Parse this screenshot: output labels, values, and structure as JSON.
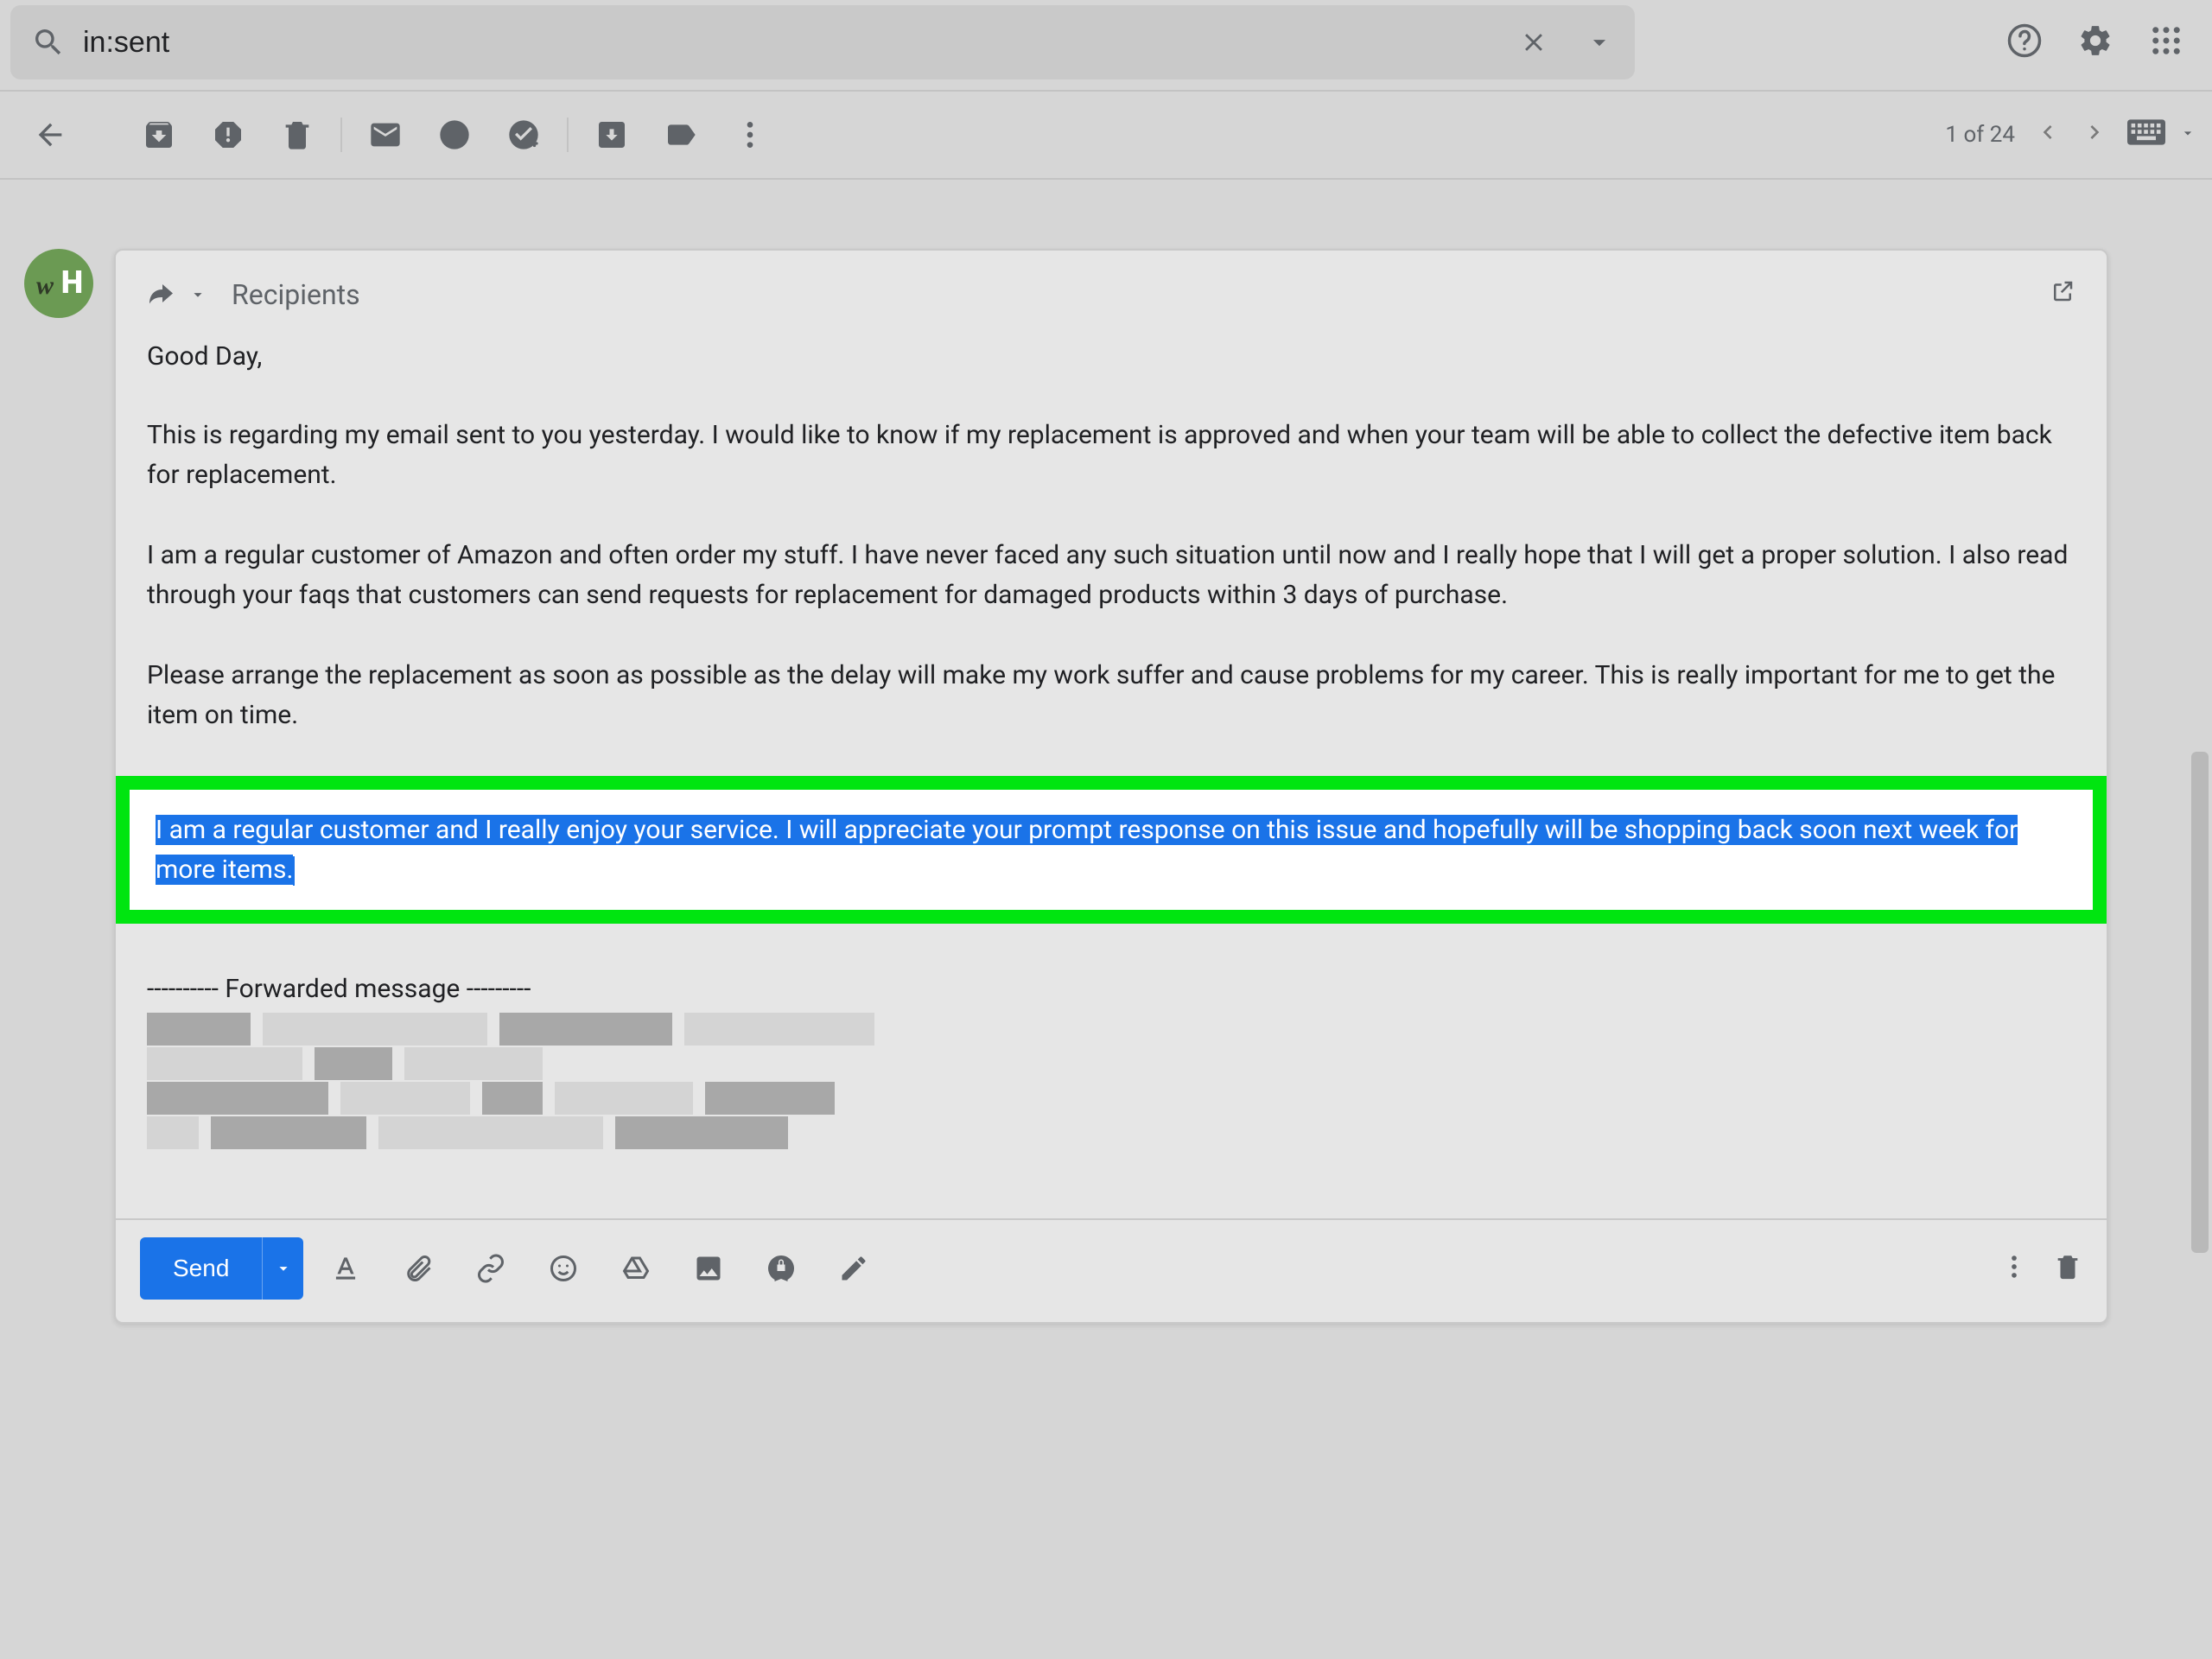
{
  "search": {
    "value": "in:sent"
  },
  "toolbar": {
    "pager": "1 of 24"
  },
  "compose": {
    "recipients_label": "Recipients",
    "greeting": "Good Day,",
    "para1": "This is regarding my email sent to you yesterday. I would like to know if my replacement is approved and when your team will be able to collect the defective item back for replacement.",
    "para2": "I am a regular customer of Amazon and often order my stuff. I have never faced any such situation until now and I really hope that I will get a proper solution. I also read through your faqs that customers can send requests for replacement for damaged products within 3 days of purchase.",
    "para3": "Please arrange the replacement as soon as possible as the delay will make my work suffer and cause problems for my career. This is really important for me to get the item on time.",
    "highlighted": "I am a regular customer and I really enjoy your service. I will appreciate your prompt response on this issue and hopefully will be shopping back soon next week for more items.",
    "forwarded_line": "---------- Forwarded message ---------",
    "send_label": "Send"
  },
  "avatar": {
    "w": "w",
    "H": "H"
  }
}
